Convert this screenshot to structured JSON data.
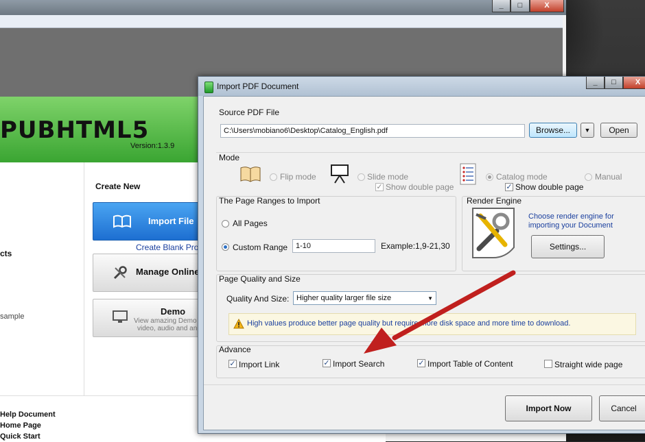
{
  "background_app": {
    "brand": "PUBHTML5",
    "version": "Version:1.3.9",
    "create_new_heading": "Create New",
    "import_file_label": "Import File",
    "create_blank_link": "Create Blank Proje",
    "manage_online_label": "Manage Online",
    "demo_label": "Demo",
    "demo_desc_line1": "View amazing Demo v",
    "demo_desc_line2": "video, audio and anin",
    "sidebar_fragment_1": "cts",
    "sidebar_fragment_2": "sample",
    "bottom_links": [
      "Help Document",
      "Home Page",
      "Quick Start"
    ],
    "caption_buttons": [
      "_",
      "□",
      "X"
    ]
  },
  "dialog": {
    "title": "Import PDF Document",
    "caption_buttons": [
      "_",
      "□",
      "X"
    ],
    "source": {
      "group_label": "Source PDF File",
      "path_value": "C:\\Users\\mobiano6\\Desktop\\Catalog_English.pdf",
      "browse_label": "Browse...",
      "dropdown_glyph": "▼",
      "open_label": "Open"
    },
    "mode": {
      "group_label": "Mode",
      "flip": "Flip mode",
      "slide": "Slide mode",
      "slide_double": "Show double page",
      "catalog": "Catalog mode",
      "catalog_double": "Show double page",
      "manual": "Manual",
      "selected": "Catalog mode"
    },
    "ranges": {
      "group_label": "The Page Ranges to Import",
      "all_pages": "All Pages",
      "custom_range": "Custom Range",
      "range_value": "1-10",
      "example": "Example:1,9-21,30",
      "selected": "Custom Range"
    },
    "render": {
      "group_label": "Render Engine",
      "desc_line1": "Choose render engine for",
      "desc_line2": "importing your Document",
      "settings_label": "Settings..."
    },
    "quality": {
      "group_label": "Page Quality and Size",
      "field_label": "Quality And Size:",
      "selected_value": "Higher quality larger file size",
      "warning": "High values produce better page quality but require more disk space and more time to download."
    },
    "advance": {
      "group_label": "Advance",
      "options": [
        {
          "label": "Import Link",
          "checked": true
        },
        {
          "label": "Import Search",
          "checked": true
        },
        {
          "label": "Import Table of Content",
          "checked": true
        },
        {
          "label": "Straight wide page",
          "checked": false
        }
      ]
    },
    "import_now_label": "Import Now",
    "cancel_label": "Cancel"
  },
  "colors": {
    "accent_green": "#3aa532",
    "accent_blue": "#1d6fd1",
    "annotation_arrow": "#c0201e"
  }
}
